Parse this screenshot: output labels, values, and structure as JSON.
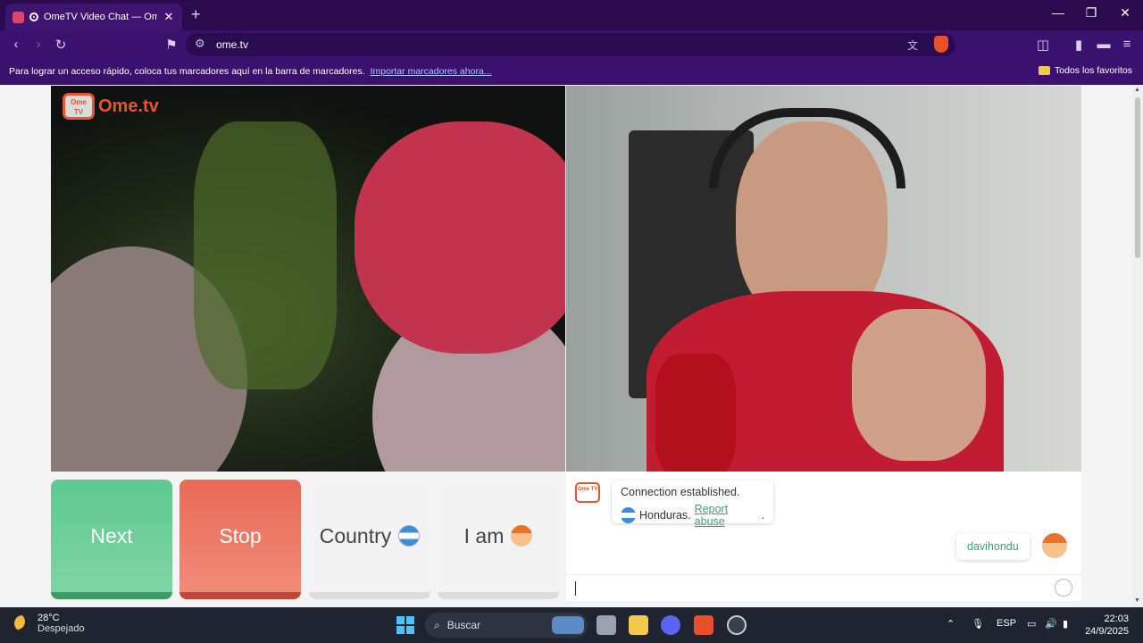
{
  "browser": {
    "tab_title": "OmeTV Video Chat — Omeg",
    "tab_close": "✕",
    "new_tab": "+",
    "url": "ome.tv",
    "bookmarks_message": "Para lograr un acceso rápido, coloca tus marcadores aquí en la barra de marcadores.",
    "bookmarks_import": "Importar marcadores ahora...",
    "all_favorites": "Todos los favoritos"
  },
  "logo": {
    "badge": "Ome TV",
    "text": "Ome.tv"
  },
  "buttons": {
    "next": "Next",
    "stop": "Stop",
    "country": "Country",
    "iam": "I am"
  },
  "chat": {
    "system_badge": "Ome TV",
    "status": "Connection established.",
    "country": "Honduras.",
    "report": "Report abuse",
    "report_suffix": ".",
    "username": "davihondu"
  },
  "taskbar": {
    "temperature": "28°C",
    "weather": "Despejado",
    "search": "Buscar",
    "language": "ESP",
    "time": "22:03",
    "date": "24/9/2025"
  },
  "colors": {
    "next": "#5ec98f",
    "stop": "#e86a57",
    "accent_green": "#3aa37c",
    "browser_purple": "#3b1170"
  }
}
